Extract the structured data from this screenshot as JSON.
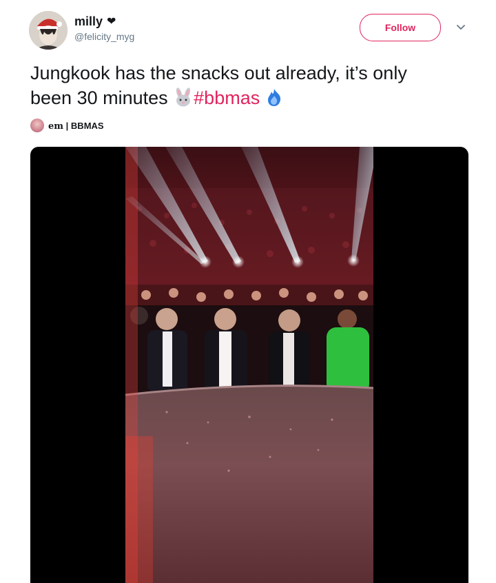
{
  "user": {
    "display_name": "milly",
    "name_suffix_icon": "black-heart-icon",
    "handle": "@felicity_myg",
    "avatar": "user-avatar-photo"
  },
  "actions": {
    "follow_label": "Follow",
    "menu_icon": "chevron-down-icon"
  },
  "tweet": {
    "text_line1": "Jungkook has the snacks out already, it’s only",
    "text_line2": "been 30 minutes",
    "emoji_1": "rabbit-face-icon",
    "hashtag": "#bbmas",
    "emoji_2": "blue-fire-icon"
  },
  "attribution": {
    "avatar": "source-avatar",
    "source_name": "em",
    "separator": "|",
    "source_tag": "BBMAS"
  },
  "media": {
    "type": "video",
    "description_icon": "concert-audience-video-frame"
  },
  "colors": {
    "hashtag": "#e0245e",
    "follow_border": "#e0245e",
    "handle_gray": "#657786",
    "text": "#14171a",
    "media_bg": "#000000"
  }
}
